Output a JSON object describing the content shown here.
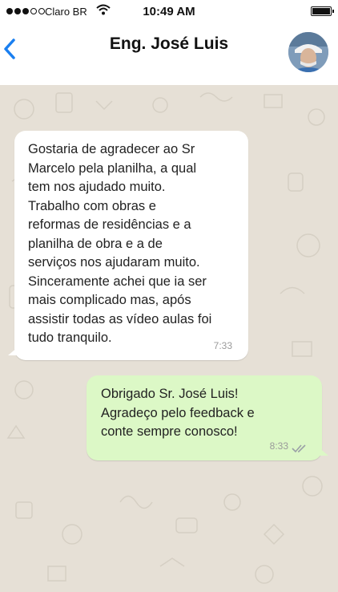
{
  "status_bar": {
    "carrier": "Claro BR",
    "time": "10:49 AM",
    "signal_icon": "signal-dots-icon",
    "wifi_icon": "wifi-icon",
    "battery_icon": "battery-icon"
  },
  "header": {
    "back_icon": "chevron-left-icon",
    "contact_name": "Eng. José Luis",
    "avatar": "contact-avatar",
    "accent_color": "#1a7ff0"
  },
  "messages": [
    {
      "direction": "incoming",
      "lines": [
        "Gostaria de agradecer ao Sr",
        "Marcelo pela planilha, a qual",
        "tem nos ajudado muito.",
        "Trabalho com obras e",
        "reformas de residências e a",
        "planilha de obra e a de",
        "serviços nos ajudaram muito.",
        "Sinceramente achei que ia ser",
        "mais complicado mas, após",
        "assistir todas as vídeo aulas foi",
        "tudo tranquilo."
      ],
      "time": "7:33",
      "bubble_color": "#ffffff"
    },
    {
      "direction": "outgoing",
      "lines": [
        "Obrigado Sr. José Luis!",
        "Agradeço pelo feedback e",
        "conte sempre conosco!"
      ],
      "time": "8:33",
      "read_icon": "double-check-icon",
      "bubble_color": "#dcf8c6"
    }
  ],
  "chat_background_color": "#e6e0d6"
}
